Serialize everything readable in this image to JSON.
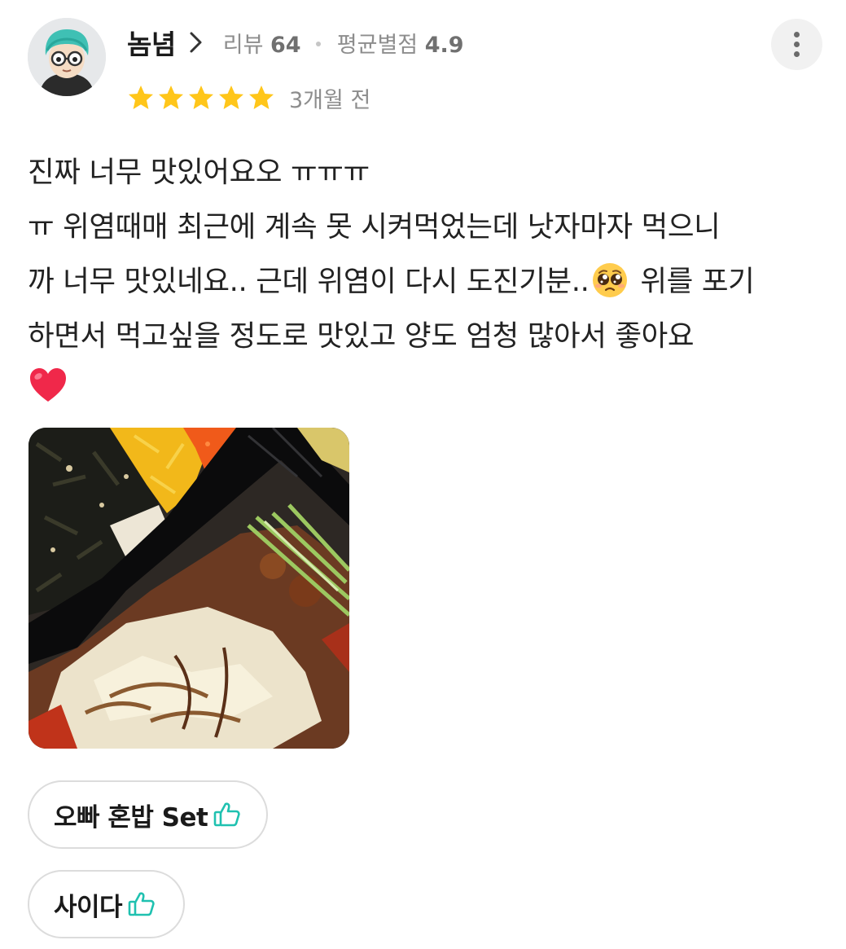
{
  "review": {
    "author": {
      "nickname": "놈념",
      "review_label": "리뷰",
      "review_count": "64",
      "avg_label": "평균별점",
      "avg_rating": "4.9"
    },
    "rating": {
      "stars": 5,
      "max_stars": 5,
      "star_color": "#FFC61A"
    },
    "date": "3개월 전",
    "text_lines": [
      "진짜 너무 맛있어요오 ㅠㅠㅠ",
      "ㅠ 위염때매 최근에 계속 못 시켜먹었는데 낫자마자 먹으니",
      "까 너무 맛있네요.. 근데 위염이 다시 도진기분..",
      "위를 포기",
      "하면서 먹고싶을 정도로 맛있고 양도 엄청 많아서 좋아요"
    ],
    "emojis": {
      "inline": "pleading-face-emoji",
      "final": "red-heart-emoji"
    },
    "photo": {
      "icon": "food-photo"
    },
    "menu_tags": [
      {
        "label": "오빠 혼밥 Set",
        "icon": "thumbs-up-icon"
      },
      {
        "label": "사이다",
        "icon": "thumbs-up-icon"
      }
    ],
    "colors": {
      "accent": "#1FC1B0",
      "text": "#222222",
      "meta": "#8D8D8D"
    }
  }
}
